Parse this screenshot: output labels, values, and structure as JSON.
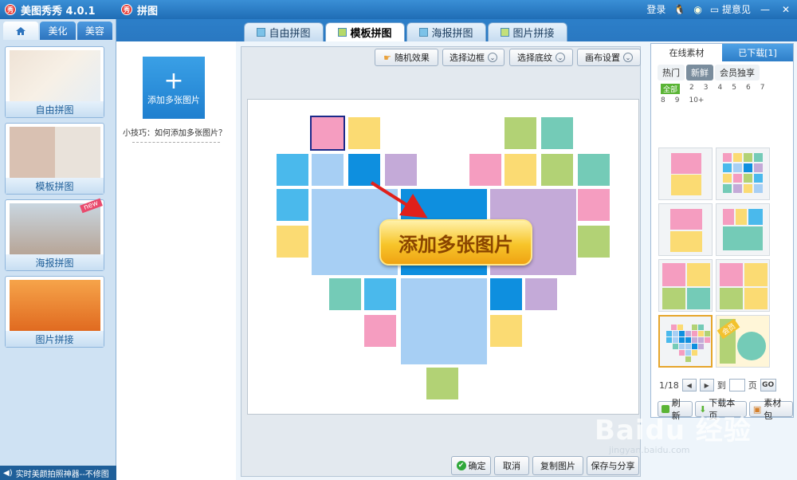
{
  "app": {
    "title": "美图秀秀 4.0.1",
    "logo": "秀"
  },
  "window": {
    "title": "拼图",
    "login": "登录",
    "feedback": "提意见"
  },
  "tabs": [
    {
      "label": "自由拼图",
      "active": false
    },
    {
      "label": "模板拼图",
      "active": true
    },
    {
      "label": "海报拼图",
      "active": false
    },
    {
      "label": "图片拼接",
      "active": false
    }
  ],
  "sidebar": {
    "tabs": [
      {
        "label": "",
        "icon": "home-icon"
      },
      {
        "label": "美化"
      },
      {
        "label": "美容"
      }
    ],
    "cards": [
      {
        "label": "自由拼图"
      },
      {
        "label": "模板拼图"
      },
      {
        "label": "海报拼图",
        "badge": "new"
      },
      {
        "label": "图片拼接"
      }
    ],
    "status": "实时美颜拍照神器--不修图"
  },
  "add_panel": {
    "button_label": "添加多张图片",
    "tip": "小技巧：如何添加多张图片？"
  },
  "toolbar": {
    "random": "随机效果",
    "border": "选择边框",
    "texture": "选择底纹",
    "canvas": "画布设置"
  },
  "canvas": {
    "cta": "添加多张图片"
  },
  "bottom": {
    "confirm": "确定",
    "cancel": "取消",
    "copy": "复制图片",
    "save": "保存与分享"
  },
  "right_panel": {
    "tab_online": "在线素材",
    "tab_downloaded": "已下载[1]",
    "filters": [
      {
        "label": "热门",
        "selected": false
      },
      {
        "label": "新鲜",
        "selected": true
      },
      {
        "label": "会员独享",
        "selected": false
      }
    ],
    "page_filters": [
      "全部",
      "2",
      "3",
      "4",
      "5",
      "6",
      "7",
      "8",
      "9",
      "10+"
    ],
    "selected_page_filter": "全部",
    "tile_badge": "会员",
    "pager": {
      "text": "1/18",
      "goto": "到",
      "page": "页",
      "go": "GO"
    },
    "actions": {
      "refresh": "刷新",
      "download_page": "下载本页",
      "pack": "素材包"
    }
  },
  "watermark": {
    "main": "Baidu 经验",
    "sub": "jingyan.baidu.com"
  },
  "colors": {
    "pink": "#f59dc0",
    "yellow": "#fbdb73",
    "green": "#b2d275",
    "teal": "#74cbb7",
    "blue": "#4ab9ec",
    "lightblue": "#a7cff4",
    "deepblue": "#0e8fdf",
    "purple": "#c4aad8"
  }
}
